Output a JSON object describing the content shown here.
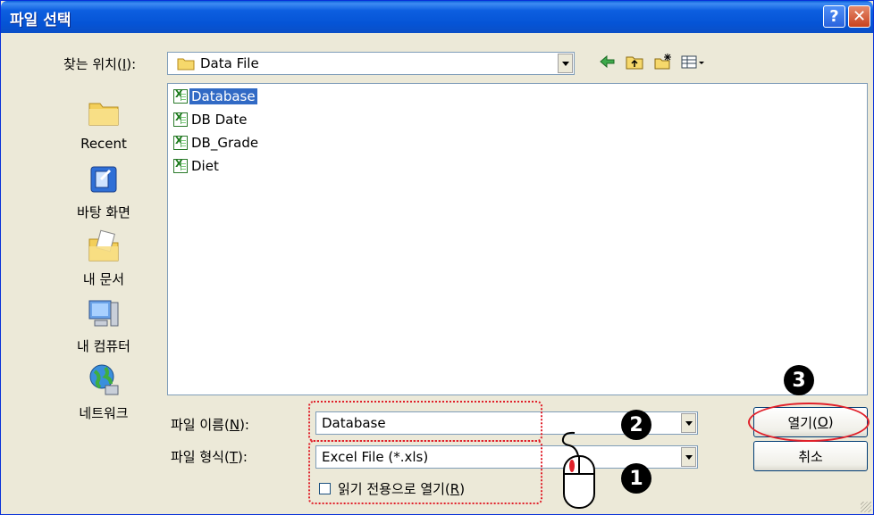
{
  "window": {
    "title": "파일 선택",
    "help_label": "?",
    "close_label": "✕"
  },
  "lookin": {
    "label_prefix": "찾는 위치(",
    "label_key": "I",
    "label_suffix": "):",
    "value": "Data File"
  },
  "places": [
    {
      "label": "Recent",
      "icon": "recent-folder-icon"
    },
    {
      "label": "바탕 화면",
      "icon": "desktop-icon"
    },
    {
      "label": "내 문서",
      "icon": "my-documents-icon"
    },
    {
      "label": "내 컴퓨터",
      "icon": "my-computer-icon"
    },
    {
      "label": "네트워크",
      "icon": "network-icon"
    }
  ],
  "files": [
    {
      "name": "Database",
      "selected": true
    },
    {
      "name": "DB Date",
      "selected": false
    },
    {
      "name": "DB_Grade",
      "selected": false
    },
    {
      "name": "Diet",
      "selected": false
    }
  ],
  "filename": {
    "label_prefix": "파일 이름(",
    "label_key": "N",
    "label_suffix": "):",
    "value": "Database"
  },
  "filetype": {
    "label_prefix": "파일 형식(",
    "label_key": "T",
    "label_suffix": "):",
    "value": "Excel File (*.xls)"
  },
  "readonly": {
    "label_prefix": "읽기 전용으로 열기(",
    "label_key": "R",
    "label_suffix": ")"
  },
  "buttons": {
    "open_prefix": "열기(",
    "open_key": "O",
    "open_suffix": ")",
    "cancel": "취소"
  },
  "markers": {
    "one": "1",
    "two": "2",
    "three": "3"
  },
  "colors": {
    "annotation": "#e0202a",
    "selection": "#316ac5"
  }
}
